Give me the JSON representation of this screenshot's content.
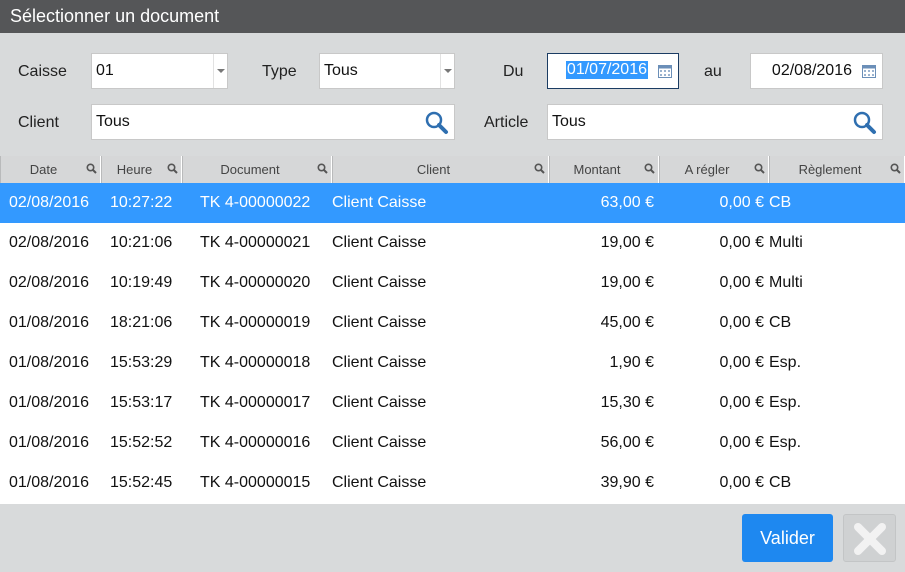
{
  "dialog": {
    "title": "Sélectionner un document"
  },
  "filters": {
    "caisse_label": "Caisse",
    "caisse_value": "01",
    "type_label": "Type",
    "type_value": "Tous",
    "du_label": "Du",
    "du_value": "01/07/2016",
    "au_label": "au",
    "au_value": "02/08/2016",
    "client_label": "Client",
    "client_value": "Tous",
    "article_label": "Article",
    "article_value": "Tous"
  },
  "grid": {
    "columns": [
      "Date",
      "Heure",
      "Document",
      "Client",
      "Montant",
      "A régler",
      "Règlement"
    ],
    "rows": [
      [
        "02/08/2016",
        "10:27:22",
        "TK 4-00000022",
        "Client Caisse",
        "63,00 €",
        "0,00 €",
        "CB"
      ],
      [
        "02/08/2016",
        "10:21:06",
        "TK 4-00000021",
        "Client Caisse",
        "19,00 €",
        "0,00 €",
        "Multi"
      ],
      [
        "02/08/2016",
        "10:19:49",
        "TK 4-00000020",
        "Client Caisse",
        "19,00 €",
        "0,00 €",
        "Multi"
      ],
      [
        "01/08/2016",
        "18:21:06",
        "TK 4-00000019",
        "Client Caisse",
        "45,00 €",
        "0,00 €",
        "CB"
      ],
      [
        "01/08/2016",
        "15:53:29",
        "TK 4-00000018",
        "Client Caisse",
        "1,90 €",
        "0,00 €",
        "Esp."
      ],
      [
        "01/08/2016",
        "15:53:17",
        "TK 4-00000017",
        "Client Caisse",
        "15,30 €",
        "0,00 €",
        "Esp."
      ],
      [
        "01/08/2016",
        "15:52:52",
        "TK 4-00000016",
        "Client Caisse",
        "56,00 €",
        "0,00 €",
        "Esp."
      ],
      [
        "01/08/2016",
        "15:52:45",
        "TK 4-00000015",
        "Client Caisse",
        "39,90 €",
        "0,00 €",
        "CB"
      ]
    ],
    "selected_row": 0
  },
  "footer": {
    "valider_label": "Valider"
  },
  "colors": {
    "accent": "#3399ff",
    "titlebar": "#555658",
    "button": "#1e88f0"
  },
  "icons": {
    "search": "magnifier-icon",
    "calendar": "calendar-icon",
    "close": "close-icon",
    "dropdown": "chevron-down-icon"
  }
}
